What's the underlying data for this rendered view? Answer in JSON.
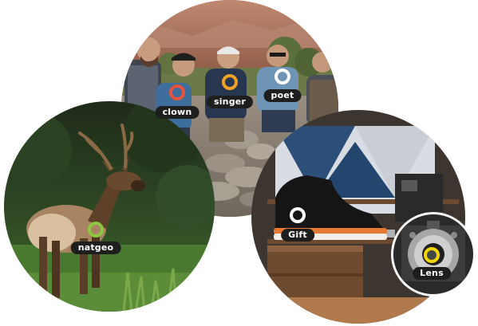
{
  "tags": {
    "clown": {
      "label": "clown",
      "ring_color": "#e8533f"
    },
    "singer": {
      "label": "singer",
      "ring_color": "#f0a024"
    },
    "poet": {
      "label": "poet",
      "ring_color": "#ffffff"
    },
    "natgeo": {
      "label": "natgeo",
      "ring_color": "#8cc63e"
    },
    "gift": {
      "label": "Gift",
      "ring_color": "#ffffff"
    },
    "lens": {
      "label": "Lens",
      "ring_color": "#f2d600"
    }
  },
  "colors": {
    "tag_background": "#1e1e1e",
    "tag_text": "#ffffff"
  }
}
